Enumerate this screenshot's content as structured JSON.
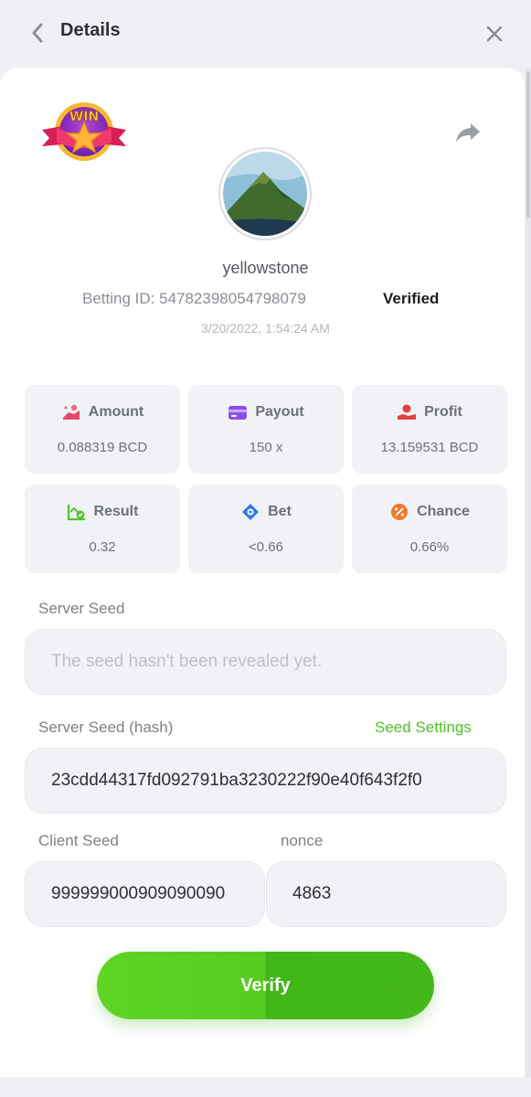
{
  "header": {
    "title": "Details"
  },
  "badge": {
    "text": "WIN"
  },
  "user": {
    "name": "yellowstone",
    "betting_id_label": "Betting ID:",
    "betting_id": "54782398054798079",
    "verified": "Verified",
    "timestamp": "3/20/2022, 1:54:24 AM"
  },
  "stats": [
    {
      "label": "Amount",
      "value": "0.088319 BCD",
      "icon": "coin-hand-icon",
      "color": "#e4486a"
    },
    {
      "label": "Payout",
      "value": "150 x",
      "icon": "card-icon",
      "color": "#8b4fe8"
    },
    {
      "label": "Profit",
      "value": "13.159531 BCD",
      "icon": "hand-heart-icon",
      "color": "#e23f3f"
    },
    {
      "label": "Result",
      "value": "0.32",
      "icon": "chart-check-icon",
      "color": "#55c332"
    },
    {
      "label": "Bet",
      "value": "<0.66",
      "icon": "target-icon",
      "color": "#2e7be8"
    },
    {
      "label": "Chance",
      "value": "0.66%",
      "icon": "percent-icon",
      "color": "#f07a2a"
    }
  ],
  "server_seed": {
    "label": "Server Seed",
    "placeholder": "The seed hasn't been revealed yet."
  },
  "server_seed_hash": {
    "label": "Server Seed (hash)",
    "value": "23cdd44317fd092791ba3230222f90e40f643f2f0",
    "settings_link": "Seed Settings"
  },
  "client_seed": {
    "label": "Client Seed",
    "value": "999999000909090090"
  },
  "nonce": {
    "label": "nonce",
    "value": "4863"
  },
  "verify_button": {
    "label": "Verify"
  },
  "colors": {
    "accent": "#4dc225",
    "button": "#52c720"
  }
}
